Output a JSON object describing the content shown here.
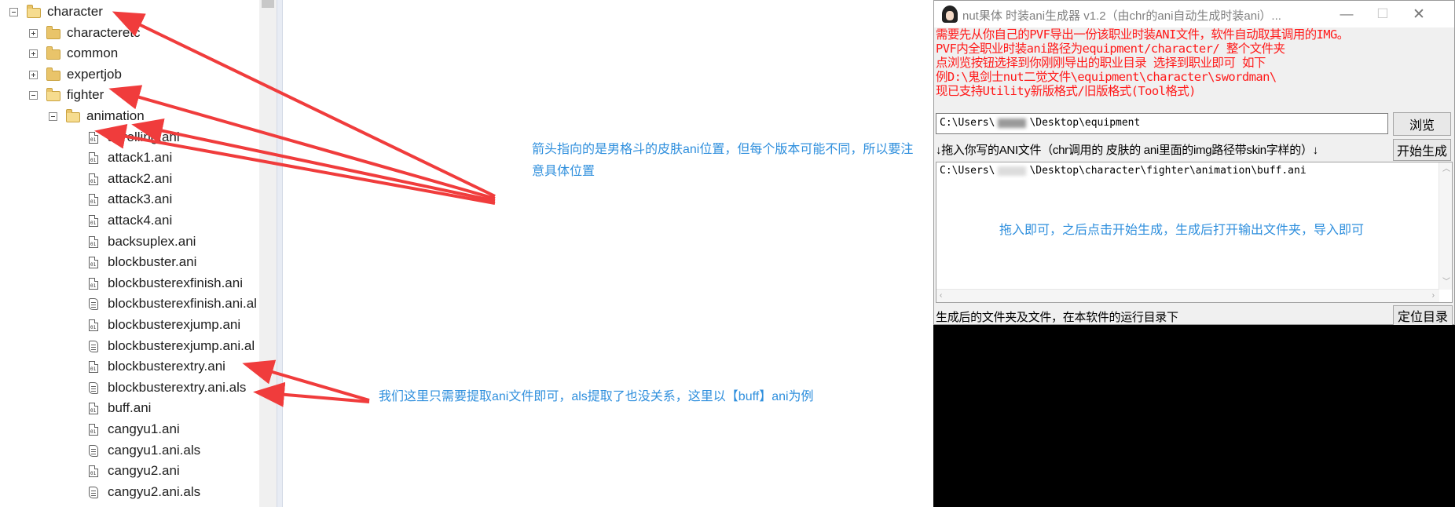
{
  "tree": {
    "items": [
      {
        "label": "character",
        "kind": "folder-open",
        "expander": "minus"
      },
      {
        "label": "characteretc",
        "kind": "folder",
        "expander": "plus"
      },
      {
        "label": "common",
        "kind": "folder",
        "expander": "plus"
      },
      {
        "label": "expertjob",
        "kind": "folder",
        "expander": "plus"
      },
      {
        "label": "fighter",
        "kind": "folder-open",
        "expander": "minus"
      },
      {
        "label": "animation",
        "kind": "folder-open",
        "expander": "minus"
      },
      {
        "label": "airrolling.ani",
        "kind": "ani"
      },
      {
        "label": "attack1.ani",
        "kind": "ani"
      },
      {
        "label": "attack2.ani",
        "kind": "ani"
      },
      {
        "label": "attack3.ani",
        "kind": "ani"
      },
      {
        "label": "attack4.ani",
        "kind": "ani"
      },
      {
        "label": "backsuplex.ani",
        "kind": "ani"
      },
      {
        "label": "blockbuster.ani",
        "kind": "ani"
      },
      {
        "label": "blockbusterexfinish.ani",
        "kind": "ani"
      },
      {
        "label": "blockbusterexfinish.ani.al",
        "kind": "als"
      },
      {
        "label": "blockbusterexjump.ani",
        "kind": "ani"
      },
      {
        "label": "blockbusterexjump.ani.al",
        "kind": "als"
      },
      {
        "label": "blockbusterextry.ani",
        "kind": "ani"
      },
      {
        "label": "blockbusterextry.ani.als",
        "kind": "als"
      },
      {
        "label": "buff.ani",
        "kind": "ani"
      },
      {
        "label": "cangyu1.ani",
        "kind": "ani"
      },
      {
        "label": "cangyu1.ani.als",
        "kind": "als"
      },
      {
        "label": "cangyu2.ani",
        "kind": "ani"
      },
      {
        "label": "cangyu2.ani.als",
        "kind": "als"
      }
    ]
  },
  "annotations": {
    "top": "箭头指向的是男格斗的皮肤ani位置，但每个版本可能不同，所以要注意具体位置",
    "bottom": "我们这里只需要提取ani文件即可，als提取了也没关系，这里以【buff】ani为例",
    "arrow_color": "#f03c3c",
    "text_color": "#2f8fdd"
  },
  "tool": {
    "title": "nut果体 时装ani生成器 v1.2（由chr的ani自动生成时装ani）...",
    "controls": {
      "minimize": "—",
      "maximize": "☐",
      "close": "✕"
    },
    "instructions": [
      "需要先从你自己的PVF导出一份该职业时装ANI文件，软件自动取其调用的IMG。",
      "PVF内全职业时装ani路径为equipment/character/ 整个文件夹",
      "点浏览按钮选择到你刚刚导出的职业目录 选择到职业即可 如下",
      "例D:\\鬼剑士nut二觉文件\\equipment\\character\\swordman\\",
      "现已支持Utility新版格式/旧版格式(Tool格式)"
    ],
    "path_prefix": "C:\\Users\\",
    "path_suffix": "\\Desktop\\equipment",
    "browse_label": "浏览",
    "drop_hint": "↓拖入你写的ANI文件（chr调用的 皮肤的 ani里面的img路径带skin字样的）↓",
    "generate_label": "开始生成",
    "drop_prefix": "C:\\Users\\",
    "drop_suffix": "\\Desktop\\character\\fighter\\animation\\buff.ani",
    "drop_note": "拖入即可，之后点击开始生成，生成后打开输出文件夹，导入即可",
    "status": "生成后的文件夹及文件，在本软件的运行目录下",
    "locate_label": "定位目录",
    "instruction_color": "#ff1a1a"
  }
}
